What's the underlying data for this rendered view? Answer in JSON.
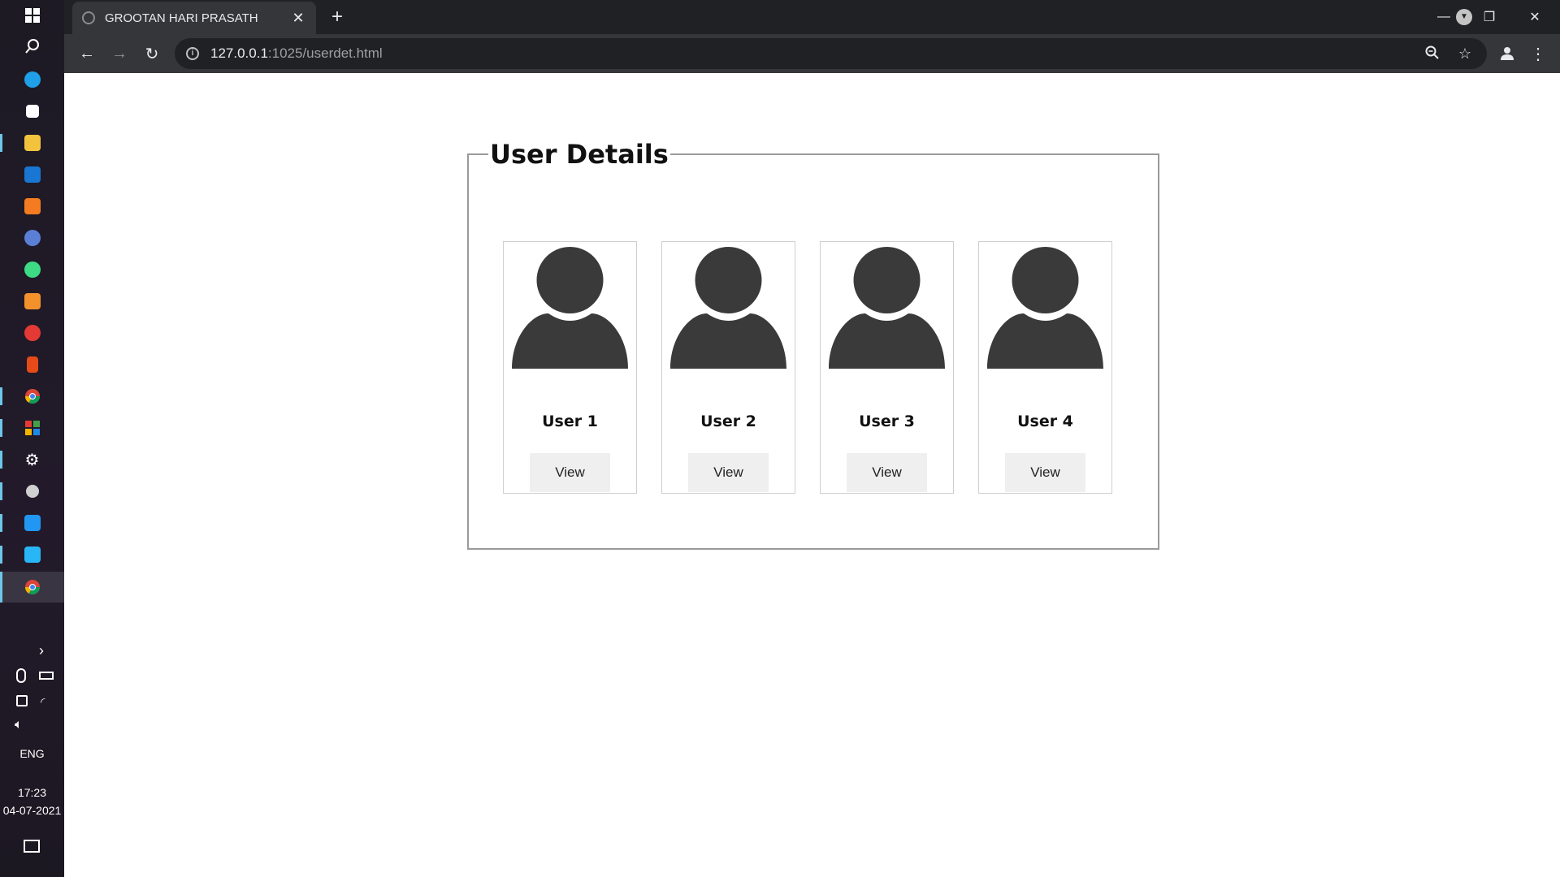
{
  "browser": {
    "tab_title": "GROOTAN HARI PRASATH",
    "tab_close": "✕",
    "new_tab": "+",
    "url_host": "127.0.0.1",
    "url_path": ":1025/userdet.html",
    "controls": {
      "minimize": "—",
      "restore": "❐",
      "close": "✕"
    }
  },
  "taskbar": {
    "apps": [
      {
        "icon": "windows-start-icon",
        "color": "#ffffff"
      },
      {
        "icon": "search-icon",
        "color": "#ffffff"
      },
      {
        "icon": "edge-icon",
        "color": "#1fa0e8"
      },
      {
        "icon": "store-icon",
        "color": "#ffffff"
      },
      {
        "icon": "file-explorer-icon",
        "color": "#f3c33d"
      },
      {
        "icon": "mail-icon",
        "color": "#1976d2"
      },
      {
        "icon": "xampp-icon",
        "color": "#f47b20"
      },
      {
        "icon": "app-icon",
        "color": "#5b7fd6"
      },
      {
        "icon": "android-studio-icon",
        "color": "#3ddc84"
      },
      {
        "icon": "sublime-text-icon",
        "color": "#f3922b"
      },
      {
        "icon": "snip-icon",
        "color": "#e53935"
      },
      {
        "icon": "office-icon",
        "color": "#e64a19"
      },
      {
        "icon": "chrome-icon",
        "color": "#4caf50"
      },
      {
        "icon": "tiles-icon",
        "color": "#f4b400"
      },
      {
        "icon": "settings-icon",
        "color": "#ffffff"
      },
      {
        "icon": "game-icon",
        "color": "#d0d0d0"
      },
      {
        "icon": "vscode-icon",
        "color": "#2196f3"
      },
      {
        "icon": "app-icon",
        "color": "#29b6f6"
      },
      {
        "icon": "chrome-active-icon",
        "color": "#4caf50"
      }
    ],
    "language": "ENG",
    "time": "17:23",
    "date": "04-07-2021"
  },
  "page": {
    "legend": "User Details",
    "users": [
      {
        "name": "User 1",
        "button": "View"
      },
      {
        "name": "User 2",
        "button": "View"
      },
      {
        "name": "User 3",
        "button": "View"
      },
      {
        "name": "User 4",
        "button": "View"
      }
    ]
  },
  "colors": {
    "avatar": "#3a3a3a",
    "card_border": "#cfcfcf",
    "button_bg": "#efefef"
  }
}
